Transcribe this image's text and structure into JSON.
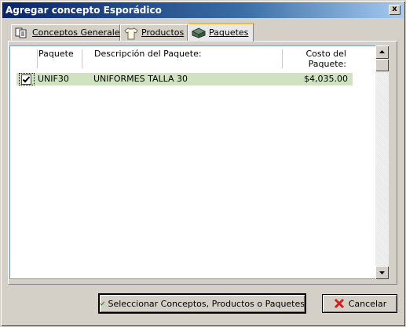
{
  "window": {
    "title": "Agregar concepto Esporádico",
    "close_glyph": "x"
  },
  "tabs": [
    {
      "label": "Conceptos Generales",
      "icon": "document-icon"
    },
    {
      "label": "Productos",
      "icon": "shirt-icon"
    },
    {
      "label": "Paquetes",
      "icon": "box-icon",
      "active": true
    }
  ],
  "grid": {
    "columns": [
      "Paquete",
      "Descripción del Paquete:",
      "Costo del Paquete:"
    ],
    "rows": [
      {
        "checked": true,
        "paquete": "UNIF30",
        "descripcion": "UNIFORMES TALLA 30",
        "costo": "$4,035.00"
      }
    ]
  },
  "buttons": {
    "select_label": "Seleccionar Conceptos, Productos o Paquetes",
    "cancel_label": "Cancelar"
  },
  "colors": {
    "selected_row": "#cfe3c0",
    "title_gradient_start": "#0a246a",
    "active_tab_accent": "#f4b840"
  }
}
